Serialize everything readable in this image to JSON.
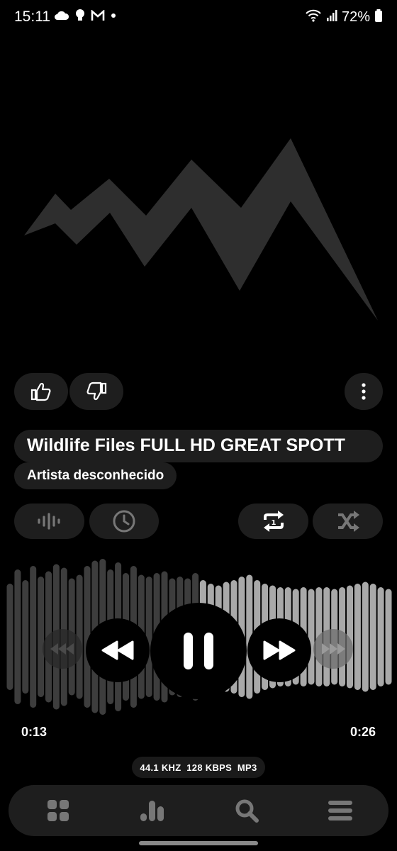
{
  "status_bar": {
    "time": "15:11",
    "left_icons": [
      "cloud-icon",
      "lightbulb-icon",
      "gmail-icon",
      "dot-icon"
    ],
    "right_icons": [
      "wifi-icon",
      "signal-icon",
      "battery-icon"
    ],
    "battery": "72%"
  },
  "track": {
    "title": "Wildlife Files FULL HD GREAT SPOTT",
    "artist": "Artista desconhecido"
  },
  "actions": {
    "like_icon": "thumbs-up-icon",
    "dislike_icon": "thumbs-down-icon",
    "menu_icon": "more-vertical-icon"
  },
  "toolbar": {
    "items": [
      "equalizer-icon",
      "clock-icon",
      "repeat-one-icon",
      "shuffle-icon"
    ]
  },
  "player": {
    "elapsed": "0:13",
    "total": "0:26",
    "progress": 0.5,
    "format": "44.1 KHZ  128 KBPS  MP3",
    "controls": [
      "previous-icon",
      "rewind-icon",
      "pause-icon",
      "fast-forward-icon",
      "next-icon"
    ]
  },
  "bottom_nav": {
    "items": [
      "grid-icon",
      "bar-chart-icon",
      "search-icon",
      "menu-icon"
    ]
  },
  "colors": {
    "background": "#000000",
    "pill": "#1e1e1e",
    "wave_played": "#3d3d3d",
    "wave_remaining": "#a9a9a9",
    "icon_gray": "#777777"
  }
}
